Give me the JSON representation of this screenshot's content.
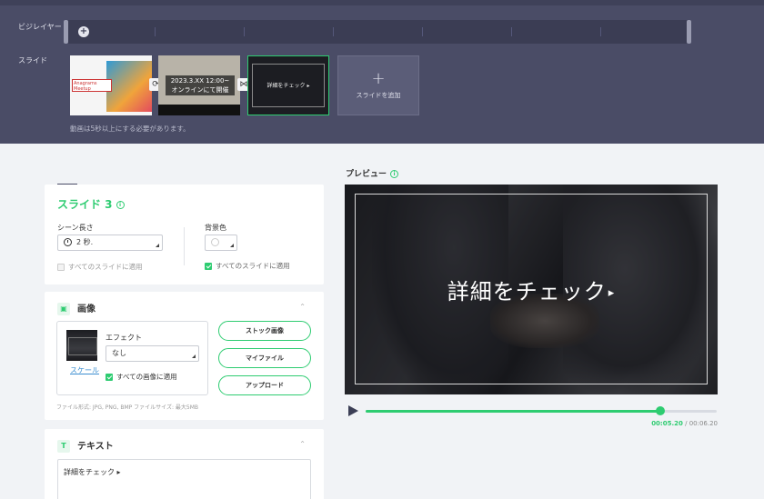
{
  "timeline": {
    "bg_player_label": "ビジレイヤー",
    "slide_label": "スライド",
    "thumb1_text": "Anagrams Meetup",
    "thumb2_line1": "2023.3.XX 12:00~",
    "thumb2_line2": "オンラインにて開催",
    "thumb3_text": "詳細をチェック ▸",
    "add_slide_plus": "+",
    "add_slide_label": "スライドを追加",
    "notice": "動画は5秒以上にする必要があります。"
  },
  "slide_settings": {
    "title": "スライド 3",
    "scene_length_label": "シーン長さ",
    "scene_length_value": "2 秒.",
    "apply_all_1": "すべてのスライドに適用",
    "bg_color_label": "背景色",
    "apply_all_2": "すべてのスライドに適用"
  },
  "image_section": {
    "title": "画像",
    "scale_link": "スケール",
    "effect_label": "エフェクト",
    "effect_value": "なし",
    "apply_all_images": "すべての画像に適用",
    "stock_button": "ストック画像",
    "myfile_button": "マイファイル",
    "upload_button": "アップロード",
    "file_note": "ファイル形式: JPG, PNG, BMP ファイルサイズ: 最大5MB"
  },
  "text_section": {
    "title": "テキスト",
    "content": "詳細をチェック ▸"
  },
  "preview": {
    "label": "プレビュー",
    "caption": "詳細をチェック",
    "caption_arrow": "▸",
    "current_time": "00:05.20",
    "separator": " / ",
    "total_time": "00:06.20",
    "progress_fraction": 0.839
  },
  "colors": {
    "accent": "#2ecc71",
    "timeline_bg": "#4a4c66"
  }
}
